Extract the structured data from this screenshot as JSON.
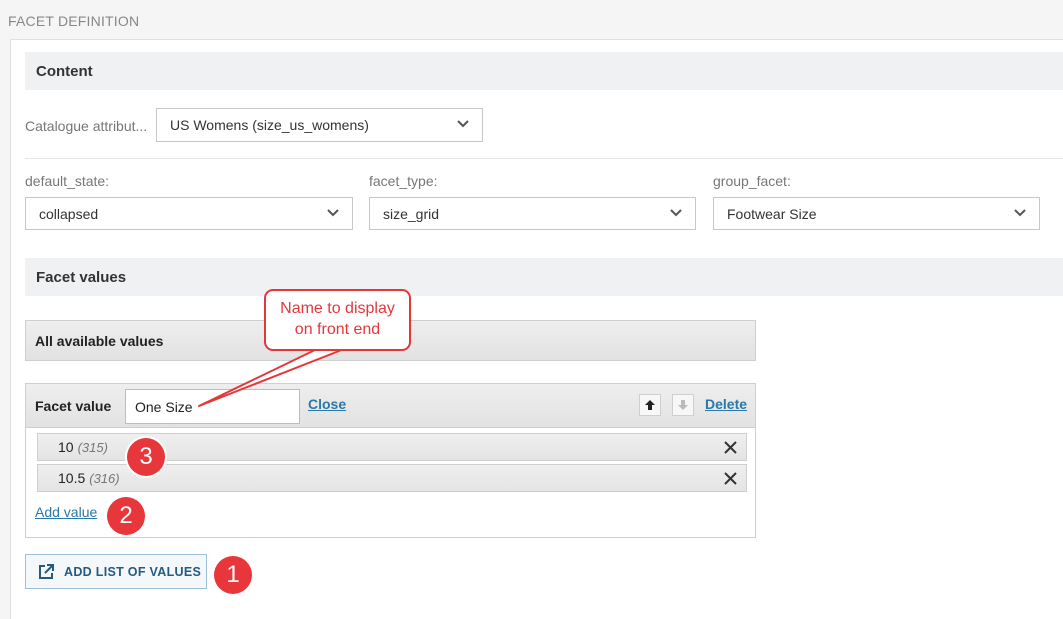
{
  "page_title": "FACET DEFINITION",
  "content_section": {
    "title": "Content",
    "catalogue_attribute_label": "Catalogue attribut...",
    "catalogue_attribute_value": "US Womens (size_us_womens)",
    "default_state_label": "default_state:",
    "default_state_value": "collapsed",
    "facet_type_label": "facet_type:",
    "facet_type_value": "size_grid",
    "group_facet_label": "group_facet:",
    "group_facet_value": "Footwear Size"
  },
  "facet_values_section": {
    "title": "Facet values",
    "all_values_title": "All available values",
    "facet_value_label": "Facet value",
    "facet_value_input": "One Size",
    "close_label": "Close",
    "delete_label": "Delete",
    "values": [
      {
        "value": "10",
        "count": "(315)"
      },
      {
        "value": "10.5",
        "count": "(316)"
      }
    ],
    "add_value_label": "Add value"
  },
  "add_list_button": {
    "label": "ADD LIST OF VALUES",
    "icon": "external-link-icon"
  },
  "annotations": {
    "callout_text": "Name to display on front end",
    "callout_line1": "Name to display",
    "callout_line2": "on front end",
    "badge_1": "1",
    "badge_2": "2",
    "badge_3": "3",
    "color": "#e8373a"
  },
  "colors": {
    "link": "#2a79a8",
    "section_bg": "#f0f1f2",
    "button_border": "#9cc0d8"
  }
}
